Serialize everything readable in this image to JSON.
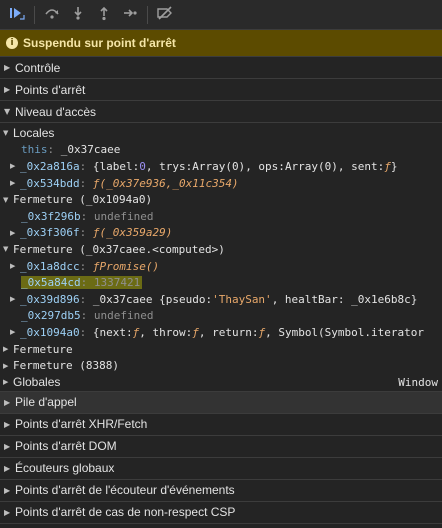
{
  "toolbar": {
    "buttons": [
      {
        "icon": "resume-icon",
        "color": "#7cacf8"
      },
      {
        "icon": "step-over-icon"
      },
      {
        "icon": "step-into-icon"
      },
      {
        "icon": "step-out-icon"
      },
      {
        "icon": "step-icon"
      },
      {
        "icon": "deactivate-breakpoints-icon"
      }
    ]
  },
  "banner": {
    "text": "Suspendu sur point d'arrêt",
    "color": "#5c4b00"
  },
  "sections_top": [
    {
      "label": "Contrôle",
      "expanded": false
    },
    {
      "label": "Points d'arrêt",
      "expanded": false
    },
    {
      "label": "Niveau d'accès",
      "expanded": true
    }
  ],
  "scope": {
    "locales": {
      "label": "Locales",
      "this_key": "this",
      "this_val": "_0x37caee",
      "r1_key": "_0x2a816a",
      "r1_p1": "{label: ",
      "r1_v1": "0",
      "r1_p2": ", trys: ",
      "r1_v2": "Array(0)",
      "r1_p3": ", ops: ",
      "r1_v3": "Array(0)",
      "r1_p4": ", sent: ",
      "r1_v4": "ƒ",
      "r1_p5": "}",
      "r2_key": "_0x534bdd",
      "r2_f": "ƒ",
      "r2_v": " (_0x37e936,_0x11c354)"
    },
    "fermeture1": {
      "label": "Fermeture (_0x1094a0)",
      "a_key": "_0x3f296b",
      "a_val": "undefined",
      "b_key": "_0x3f306f",
      "b_f": "ƒ",
      "b_v": " (_0x359a29)"
    },
    "fermeture2": {
      "label": "Fermeture (_0x37caee.<computed>)",
      "a_key": "_0x1a8dcc",
      "a_f": "ƒ",
      "a_v": " Promise()",
      "b_key": "_0x5a84cd",
      "b_val": "1337421",
      "c_key": "_0x39d896",
      "c_p1": "_0x37caee {pseudo: ",
      "c_s": "'ThaySan'",
      "c_p2": ", healtBar: _0x1e6b8c}",
      "d_key": "_0x297db5",
      "d_val": "undefined",
      "e_key": "_0x1094a0",
      "e_p1": "{next: ",
      "e_f1": "ƒ",
      "e_p2": ", throw: ",
      "e_f2": "ƒ",
      "e_p3": ", return: ",
      "e_f3": "ƒ",
      "e_p4": ", Symbol(Symbol.iterator"
    },
    "fermeture3": "Fermeture",
    "fermeture4": "Fermeture (8388)",
    "globales": "Globales",
    "globales_val": "Window"
  },
  "sections_bottom": [
    {
      "label": "Pile d'appel"
    },
    {
      "label": "Points d'arrêt XHR/Fetch"
    },
    {
      "label": "Points d'arrêt DOM"
    },
    {
      "label": "Écouteurs globaux"
    },
    {
      "label": "Points d'arrêt de l'écouteur d'événements"
    },
    {
      "label": "Points d'arrêt de cas de non-respect CSP"
    }
  ]
}
